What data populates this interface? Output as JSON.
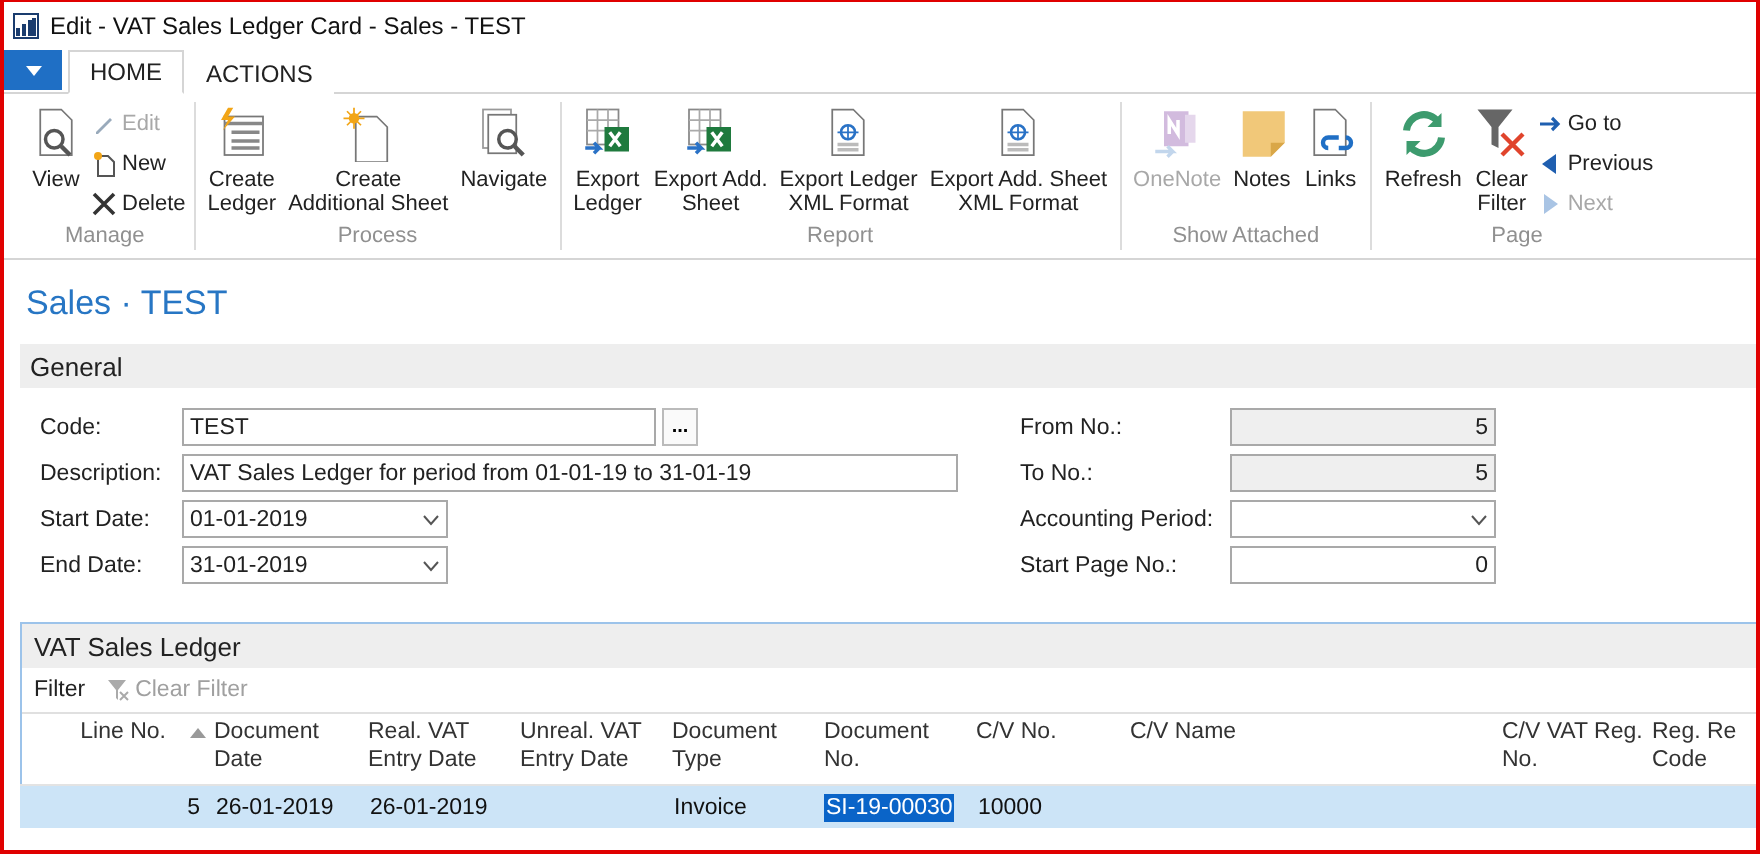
{
  "window": {
    "title": "Edit - VAT Sales Ledger Card - Sales - TEST"
  },
  "tabs": [
    {
      "label": "HOME",
      "selected": true
    },
    {
      "label": "ACTIONS",
      "selected": false
    }
  ],
  "ribbon": [
    {
      "label": "Manage",
      "large": [
        {
          "lines": [
            "View"
          ],
          "disabled": false
        }
      ],
      "small": [
        {
          "label": "Edit",
          "disabled": true
        },
        {
          "label": "New",
          "disabled": false
        },
        {
          "label": "Delete",
          "disabled": false
        }
      ]
    },
    {
      "label": "Process",
      "large": [
        {
          "lines": [
            "Create",
            "Ledger"
          ],
          "disabled": false
        },
        {
          "lines": [
            "Create",
            "Additional Sheet"
          ],
          "disabled": false
        },
        {
          "lines": [
            "Navigate"
          ],
          "disabled": false
        }
      ]
    },
    {
      "label": "Report",
      "large": [
        {
          "lines": [
            "Export",
            "Ledger"
          ],
          "disabled": false
        },
        {
          "lines": [
            "Export Add.",
            "Sheet"
          ],
          "disabled": false
        },
        {
          "lines": [
            "Export Ledger",
            "XML Format"
          ],
          "disabled": false
        },
        {
          "lines": [
            "Export Add. Sheet",
            "XML Format"
          ],
          "disabled": false
        }
      ]
    },
    {
      "label": "Show Attached",
      "large": [
        {
          "lines": [
            "OneNote"
          ],
          "disabled": true
        },
        {
          "lines": [
            "Notes"
          ],
          "disabled": false
        },
        {
          "lines": [
            "Links"
          ],
          "disabled": false
        }
      ]
    },
    {
      "label": "Page",
      "large": [
        {
          "lines": [
            "Refresh"
          ],
          "disabled": false
        },
        {
          "lines": [
            "Clear",
            "Filter"
          ],
          "disabled": false
        }
      ],
      "small": [
        {
          "label": "Go to",
          "disabled": false
        },
        {
          "label": "Previous",
          "disabled": false
        },
        {
          "label": "Next",
          "disabled": true
        }
      ]
    }
  ],
  "page_title": "Sales · TEST",
  "general": {
    "title": "General",
    "left": [
      {
        "label": "Code:",
        "value": "TEST",
        "kind": "lookup",
        "button": "..."
      },
      {
        "label": "Description:",
        "value": "VAT Sales Ledger for period from 01-01-19 to 31-01-19",
        "kind": "text"
      },
      {
        "label": "Start Date:",
        "value": "01-01-2019",
        "kind": "date"
      },
      {
        "label": "End Date:",
        "value": "31-01-2019",
        "kind": "date"
      }
    ],
    "right": [
      {
        "label": "From No.:",
        "value": "5",
        "kind": "readonly"
      },
      {
        "label": "To No.:",
        "value": "5",
        "kind": "readonly"
      },
      {
        "label": "Accounting Period:",
        "kind": "select"
      },
      {
        "label": "Start Page No.:",
        "value": "0",
        "kind": "number"
      }
    ]
  },
  "ledger": {
    "title": "VAT Sales Ledger",
    "filter": {
      "label": "Filter"
    },
    "clear_filter": {
      "label": "Clear Filter",
      "disabled": true
    },
    "columns": [
      {
        "lines": [
          "Line No."
        ],
        "sorted": true
      },
      {
        "lines": [
          "Document",
          "Date"
        ],
        "sorted": false
      },
      {
        "lines": [
          "Real. VAT",
          "Entry Date"
        ],
        "sorted": false
      },
      {
        "lines": [
          "Unreal. VAT",
          "Entry Date"
        ],
        "sorted": false
      },
      {
        "lines": [
          "Document",
          "Type"
        ],
        "sorted": false
      },
      {
        "lines": [
          "Document",
          "No."
        ],
        "sorted": false
      },
      {
        "lines": [
          "C/V No."
        ],
        "sorted": false
      },
      {
        "lines": [
          "C/V Name"
        ],
        "sorted": false
      },
      {
        "lines": [
          "C/V VAT Reg.",
          "No."
        ],
        "sorted": false
      },
      {
        "lines": [
          "Reg. Re",
          "Code"
        ],
        "sorted": false
      }
    ],
    "rows": [
      {
        "selected": true,
        "cells": [
          {
            "text": "5",
            "selected": false
          },
          {
            "text": "26-01-2019",
            "selected": false
          },
          {
            "text": "26-01-2019",
            "selected": false
          },
          null,
          {
            "text": "Invoice",
            "selected": false
          },
          {
            "text": "SI-19-00030",
            "selected": true
          },
          {
            "text": "10000",
            "selected": false
          },
          null,
          null,
          null
        ]
      }
    ]
  }
}
